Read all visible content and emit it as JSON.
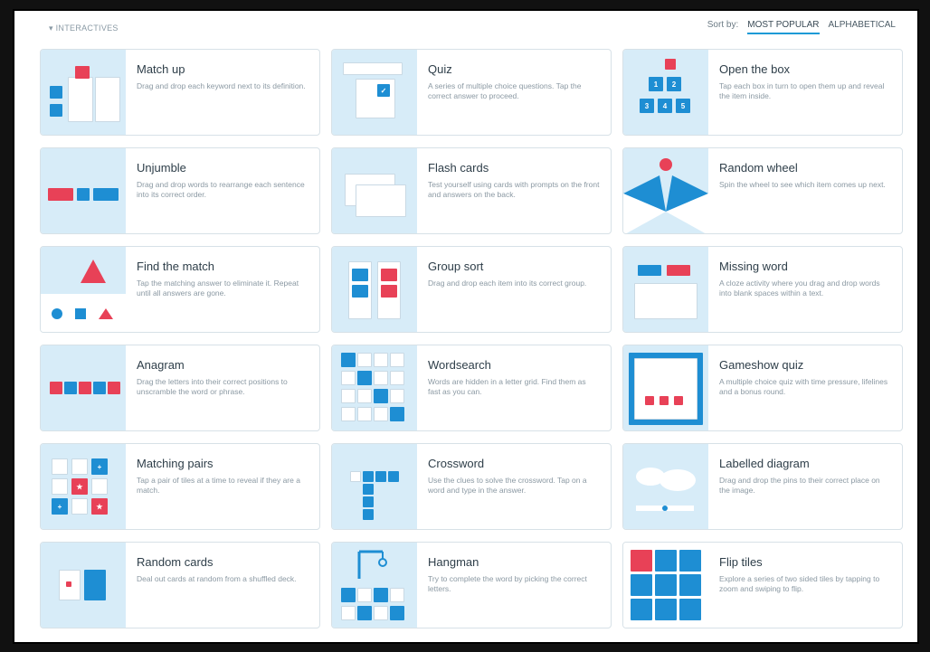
{
  "header": {
    "section_label": "▾ INTERACTIVES",
    "sort_label": "Sort by:",
    "sort_options": [
      "MOST POPULAR",
      "ALPHABETICAL"
    ]
  },
  "colors": {
    "accent_blue": "#1e8ed3",
    "accent_red": "#e84157",
    "thumb_bg": "#d7ecf8"
  },
  "templates": [
    {
      "name": "Match up",
      "desc": "Drag and drop each keyword next to its definition.",
      "icon": "match-up-icon"
    },
    {
      "name": "Quiz",
      "desc": "A series of multiple choice questions. Tap the correct answer to proceed.",
      "icon": "quiz-icon"
    },
    {
      "name": "Open the box",
      "desc": "Tap each box in turn to open them up and reveal the item inside.",
      "icon": "open-the-box-icon"
    },
    {
      "name": "Unjumble",
      "desc": "Drag and drop words to rearrange each sentence into its correct order.",
      "icon": "unjumble-icon"
    },
    {
      "name": "Flash cards",
      "desc": "Test yourself using cards with prompts on the front and answers on the back.",
      "icon": "flash-cards-icon"
    },
    {
      "name": "Random wheel",
      "desc": "Spin the wheel to see which item comes up next.",
      "icon": "random-wheel-icon"
    },
    {
      "name": "Find the match",
      "desc": "Tap the matching answer to eliminate it. Repeat until all answers are gone.",
      "icon": "find-the-match-icon"
    },
    {
      "name": "Group sort",
      "desc": "Drag and drop each item into its correct group.",
      "icon": "group-sort-icon"
    },
    {
      "name": "Missing word",
      "desc": "A cloze activity where you drag and drop words into blank spaces within a text.",
      "icon": "missing-word-icon"
    },
    {
      "name": "Anagram",
      "desc": "Drag the letters into their correct positions to unscramble the word or phrase.",
      "icon": "anagram-icon"
    },
    {
      "name": "Wordsearch",
      "desc": "Words are hidden in a letter grid. Find them as fast as you can.",
      "icon": "wordsearch-icon"
    },
    {
      "name": "Gameshow quiz",
      "desc": "A multiple choice quiz with time pressure, lifelines and a bonus round.",
      "icon": "gameshow-quiz-icon"
    },
    {
      "name": "Matching pairs",
      "desc": "Tap a pair of tiles at a time to reveal if they are a match.",
      "icon": "matching-pairs-icon"
    },
    {
      "name": "Crossword",
      "desc": "Use the clues to solve the crossword. Tap on a word and type in the answer.",
      "icon": "crossword-icon"
    },
    {
      "name": "Labelled diagram",
      "desc": "Drag and drop the pins to their correct place on the image.",
      "icon": "labelled-diagram-icon"
    },
    {
      "name": "Random cards",
      "desc": "Deal out cards at random from a shuffled deck.",
      "icon": "random-cards-icon"
    },
    {
      "name": "Hangman",
      "desc": "Try to complete the word by picking the correct letters.",
      "icon": "hangman-icon"
    },
    {
      "name": "Flip tiles",
      "desc": "Explore a series of two sided tiles by tapping to zoom and swiping to flip.",
      "icon": "flip-tiles-icon"
    }
  ]
}
